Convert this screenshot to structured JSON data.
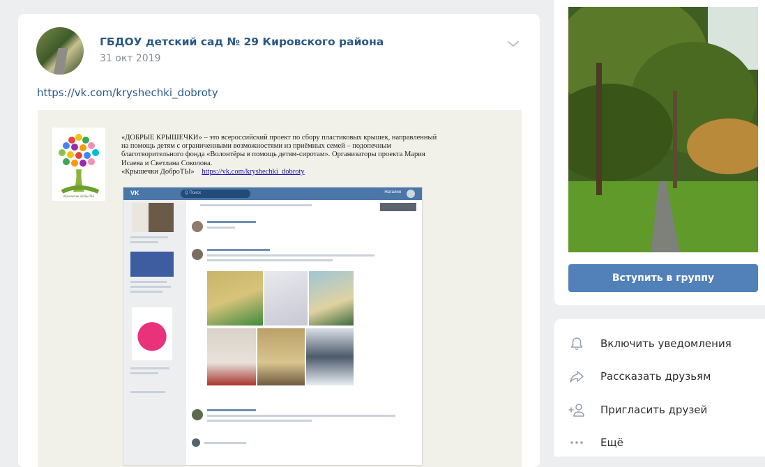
{
  "post": {
    "group_name": "ГБДОУ детский сад № 29 Кировского района",
    "date": "31 окт 2019",
    "link": "https://vk.com/kryshechki_dobroty",
    "image": {
      "paragraph_lines": [
        "«ДОБРЫЕ КРЫШЕЧКИ» – это всероссийский проект по сбору пластиковых крышек, направленный",
        "на помощь детям с ограниченными возможностями из приёмных семей – подопечным",
        "благотворительного фонда «Волонтёры в помощь детям-сиротам». Организаторы проекта Мария",
        "Исаева и Светлана Соколова."
      ],
      "caption": "«Крышечки ДоброТЫ»",
      "caption_link": "https://vk.com/kryshechki_dobroty",
      "logo_caption": "Крышечки ДоброТЫ",
      "screenshot": {
        "brand": "VK",
        "search_placeholder": "Q Поиск",
        "user": "Наталия"
      }
    }
  },
  "sidebar": {
    "join_button": "Вступить в группу",
    "actions": [
      {
        "label": "Включить уведомления",
        "icon": "bell-icon"
      },
      {
        "label": "Рассказать друзьям",
        "icon": "share-icon"
      },
      {
        "label": "Пригласить друзей",
        "icon": "add-friend-icon"
      },
      {
        "label": "Ещё",
        "icon": "more-icon"
      }
    ]
  },
  "colors": {
    "accent": "#5181b8",
    "link": "#2a5885",
    "background": "#edeef0"
  }
}
